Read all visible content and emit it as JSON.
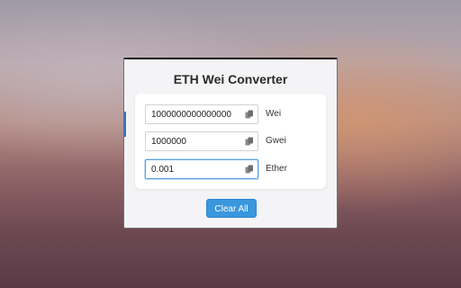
{
  "app": {
    "title": "ETH Wei Converter"
  },
  "fields": [
    {
      "value": "1000000000000000",
      "unit": "Wei",
      "copy_icon": "copy-icon"
    },
    {
      "value": "1000000",
      "unit": "Gwei",
      "copy_icon": "copy-icon"
    },
    {
      "value": "0.001",
      "unit": "Ether",
      "copy_icon": "copy-icon"
    }
  ],
  "actions": {
    "clear_label": "Clear All"
  },
  "colors": {
    "accent": "#3a97dd",
    "focus": "#5aa0e0",
    "title": "#2b2b2b"
  }
}
